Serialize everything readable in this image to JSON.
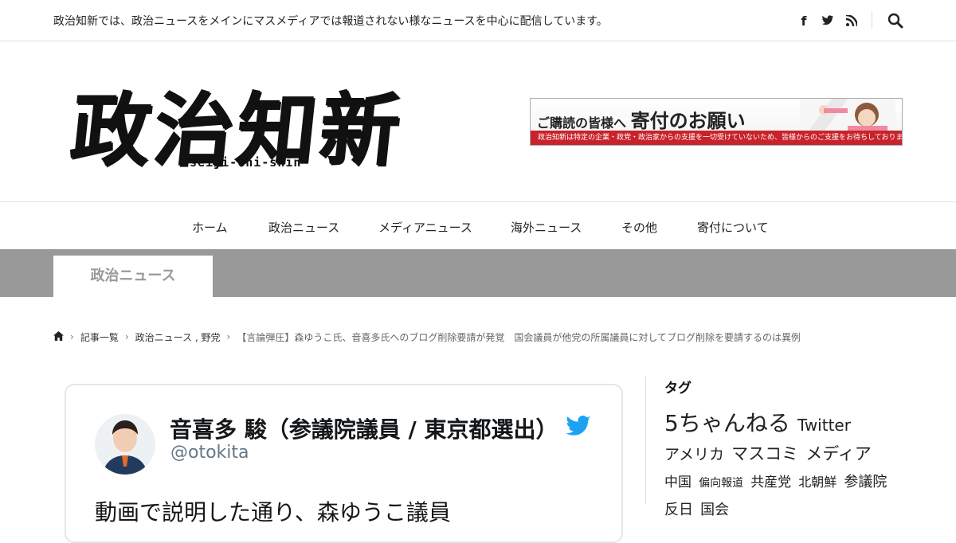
{
  "topbar": {
    "tagline": "政治知新では、政治ニュースをメインにマスメディアでは報道されない様なニュースを中心に配信しています。",
    "social_icons": [
      "facebook-icon",
      "twitter-icon",
      "rss-icon"
    ],
    "search_icon": "search-icon"
  },
  "logo": {
    "kanji": "政治知新",
    "roman": "seiji-chi-shin"
  },
  "banner": {
    "headline_small": "ご購読の皆様へ",
    "headline_big": "寄付のお願い",
    "strip_text": "政治知新は特定の企業・政党・政治家からの支援を一切受けていないため、皆様からのご支援をお待ちしております。"
  },
  "nav": {
    "items": [
      {
        "label": "ホーム"
      },
      {
        "label": "政治ニュース"
      },
      {
        "label": "メディアニュース"
      },
      {
        "label": "海外ニュース"
      },
      {
        "label": "その他"
      },
      {
        "label": "寄付について"
      }
    ]
  },
  "category": {
    "tab_label": "政治ニュース"
  },
  "breadcrumb": {
    "home_icon": "home-icon",
    "items": [
      {
        "label": "記事一覧"
      },
      {
        "label": "政治ニュース , 野党"
      }
    ],
    "current": "【言論弾圧】森ゆうこ氏、音喜多氏へのブログ削除要請が発覚　国会議員が他党の所属議員に対してブログ削除を要請するのは異例"
  },
  "embed": {
    "name": "音喜多 駿（参議院議員 / 東京都選出）",
    "handle": "@otokita",
    "text": "動画で説明した通り、森ゆうこ議員"
  },
  "sidebar": {
    "title": "タグ",
    "tags": [
      {
        "label": "5ちゃんねる"
      },
      {
        "label": "Twitter"
      },
      {
        "label": "アメリカ"
      },
      {
        "label": "マスコミ"
      },
      {
        "label": "メディア"
      },
      {
        "label": "中国"
      },
      {
        "label": "偏向報道"
      },
      {
        "label": "共産党"
      },
      {
        "label": "北朝鮮"
      },
      {
        "label": "参議院"
      },
      {
        "label": "反日"
      },
      {
        "label": "国会"
      }
    ]
  },
  "colors": {
    "category_band": "#999999",
    "banner_strip": "#c8232a",
    "twitter_blue": "#1da1f2",
    "text": "#222222"
  }
}
